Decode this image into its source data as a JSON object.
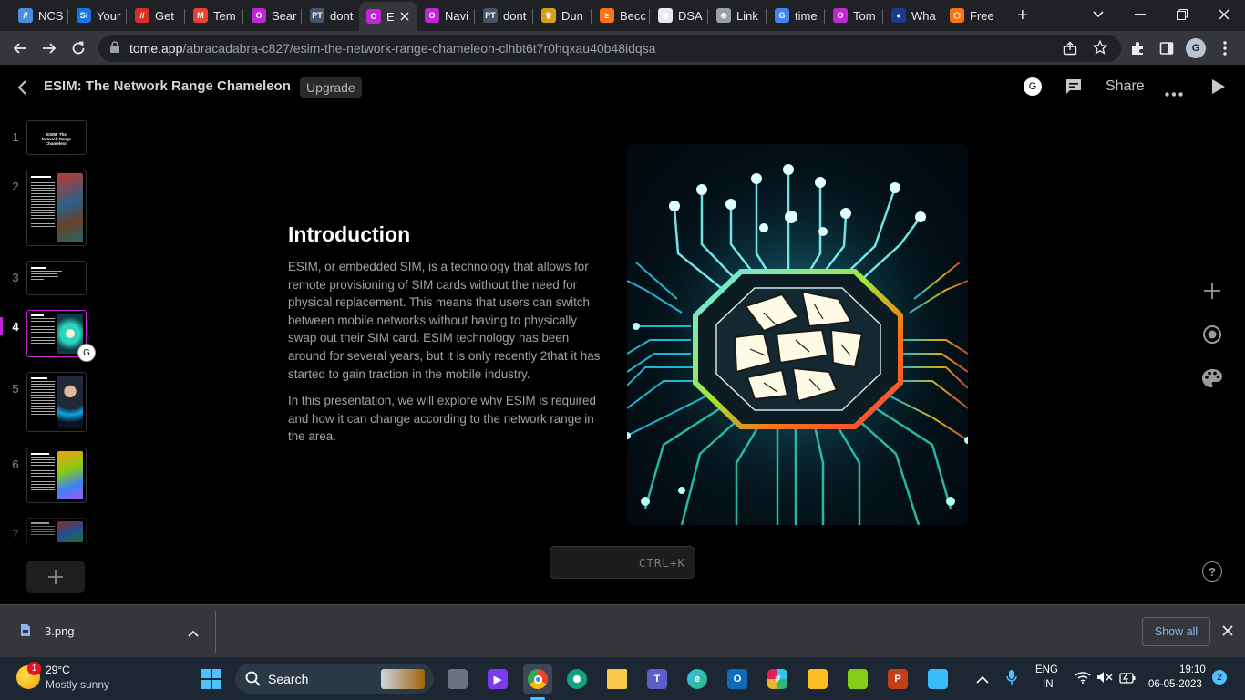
{
  "browser": {
    "tabs": [
      {
        "label": "NCS",
        "color": "#4a90d9",
        "glyph": "//"
      },
      {
        "label": "Your",
        "color": "#1a73e8",
        "glyph": "Si"
      },
      {
        "label": "Get",
        "color": "#d93025",
        "glyph": "//"
      },
      {
        "label": "Tem",
        "color": "#ea4335",
        "glyph": "M"
      },
      {
        "label": "Sear",
        "color": "#c026d3",
        "glyph": "O"
      },
      {
        "label": "dont",
        "color": "#475569",
        "glyph": "PT"
      },
      {
        "label": "E",
        "color": "#c026d3",
        "glyph": "O"
      },
      {
        "label": "Navi",
        "color": "#c026d3",
        "glyph": "O"
      },
      {
        "label": "dont",
        "color": "#475569",
        "glyph": "PT"
      },
      {
        "label": "Dun",
        "color": "#d4a017",
        "glyph": "♛"
      },
      {
        "label": "Becc",
        "color": "#f97316",
        "glyph": "≥"
      },
      {
        "label": "DSA",
        "color": "#e8eaed",
        "glyph": "◉"
      },
      {
        "label": "Link",
        "color": "#9aa0a6",
        "glyph": "⊕"
      },
      {
        "label": "time",
        "color": "#4285f4",
        "glyph": "G"
      },
      {
        "label": "Tom",
        "color": "#c026d3",
        "glyph": "O"
      },
      {
        "label": "Wha",
        "color": "#1e3a8a",
        "glyph": "●"
      },
      {
        "label": "Free",
        "color": "#f97316",
        "glyph": "⬡"
      }
    ],
    "new_tab_label": "+",
    "url": {
      "host": "tome.app",
      "path": "/abracadabra-c827/esim-the-network-range-chameleon-clhbt6t7r0hqxau40b48idqsa"
    },
    "profile_letter": "G"
  },
  "tome": {
    "title": "ESIM: The Network Range Chameleon",
    "upgrade_label": "Upgrade",
    "avatar_letter": "G",
    "share_label": "Share",
    "active_slide": 4,
    "slides": [
      {
        "num": "1",
        "thumb_title": "ESIM: The Network Range Chameleon"
      },
      {
        "num": "2"
      },
      {
        "num": "3"
      },
      {
        "num": "4"
      },
      {
        "num": "5"
      },
      {
        "num": "6"
      },
      {
        "num": "7"
      }
    ],
    "thumb_avatar_letter": "G",
    "slide": {
      "heading": "Introduction",
      "paragraph1": "ESIM, or embedded SIM, is a technology that allows for remote provisioning of SIM cards without the need for physical replacement. This means that users can switch between mobile networks without having to physically swap out their SIM card. ESIM technology has been around for several years, but it is only recently 2that it has started to gain traction in the mobile industry.",
      "paragraph2": "In this presentation, we will explore why ESIM is required and how it can change according to the network range in the area."
    },
    "command_hint": "CTRL+K",
    "help_label": "?"
  },
  "downloads": {
    "file_name": "3.png",
    "show_all_label": "Show all"
  },
  "taskbar": {
    "weather_temp": "29°C",
    "weather_desc": "Mostly sunny",
    "weather_badge": "1",
    "search_label": "Search",
    "lang_top": "ENG",
    "lang_bottom": "IN",
    "time": "19:10",
    "date": "06-05-2023",
    "notification_count": "2"
  }
}
